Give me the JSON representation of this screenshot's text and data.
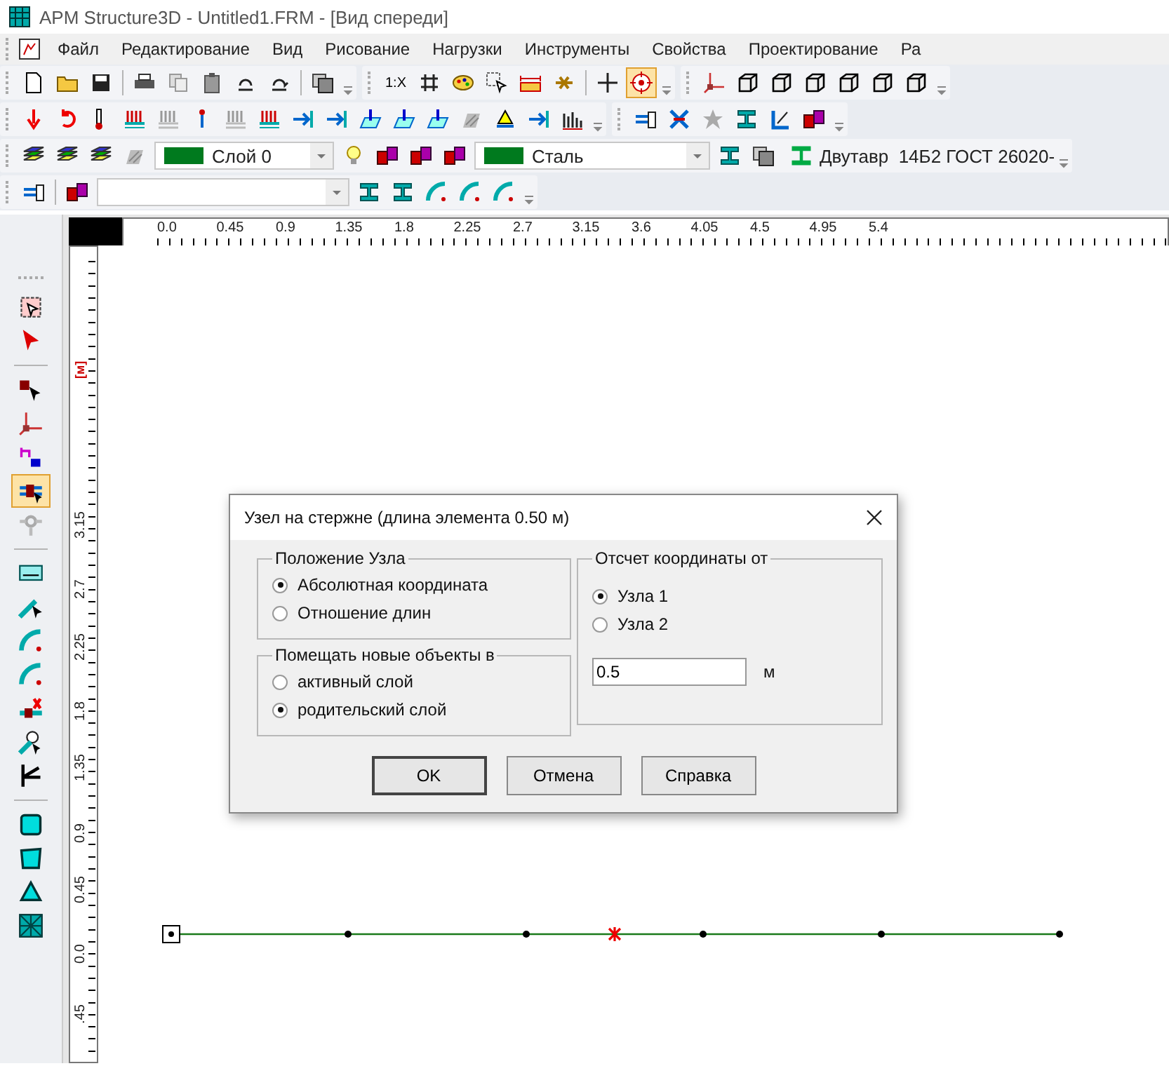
{
  "window": {
    "title": "APM Structure3D - Untitled1.FRM - [Вид спереди]"
  },
  "menu_bar": {
    "items": [
      "Файл",
      "Редактирование",
      "Вид",
      "Рисование",
      "Нагрузки",
      "Инструменты",
      "Свойства",
      "Проектирование",
      "Ра"
    ]
  },
  "toolbar_rows": [
    [
      {
        "items": [
          {
            "kind": "page",
            "selected": false
          },
          {
            "kind": "folder",
            "selected": false
          },
          {
            "kind": "disk",
            "selected": false
          },
          {
            "kind": "separator"
          },
          {
            "kind": "printer",
            "selected": false
          },
          {
            "kind": "copy",
            "selected": false
          },
          {
            "kind": "paste",
            "selected": false
          },
          {
            "kind": "undo",
            "selected": false
          },
          {
            "kind": "redo",
            "selected": false
          },
          {
            "kind": "separator"
          },
          {
            "kind": "stack",
            "selected": false
          }
        ]
      },
      {
        "items": [
          {
            "kind": "text",
            "text": "1:X",
            "selected": false
          },
          {
            "kind": "grid",
            "selected": false
          },
          {
            "kind": "palette",
            "selected": false
          },
          {
            "kind": "select",
            "selected": false
          },
          {
            "kind": "ruler",
            "selected": false
          },
          {
            "kind": "link",
            "selected": false
          },
          {
            "kind": "separator"
          },
          {
            "kind": "cross",
            "selected": false
          },
          {
            "kind": "target",
            "selected": true
          }
        ]
      },
      {
        "items": [
          {
            "kind": "axes",
            "selected": false
          },
          {
            "kind": "cube",
            "selected": false
          },
          {
            "kind": "cube",
            "selected": false
          },
          {
            "kind": "cube",
            "selected": false
          },
          {
            "kind": "cube",
            "selected": false
          },
          {
            "kind": "cube",
            "selected": false
          },
          {
            "kind": "cube",
            "selected": false
          }
        ]
      }
    ],
    [
      {
        "items": [
          {
            "kind": "down",
            "selected": false
          },
          {
            "kind": "curve",
            "selected": false
          },
          {
            "kind": "thermo",
            "selected": false
          },
          {
            "kind": "bars",
            "selected": false
          },
          {
            "kind": "greybars",
            "selected": false
          },
          {
            "kind": "figure",
            "selected": false
          },
          {
            "kind": "greybars",
            "selected": false
          },
          {
            "kind": "bars",
            "selected": false
          },
          {
            "kind": "bluearrow",
            "selected": false
          },
          {
            "kind": "bluearrow",
            "selected": false
          },
          {
            "kind": "plate",
            "selected": false
          },
          {
            "kind": "plate",
            "selected": false
          },
          {
            "kind": "plate",
            "selected": false
          },
          {
            "kind": "hatch",
            "selected": false
          },
          {
            "kind": "support",
            "selected": false
          },
          {
            "kind": "bluearrow",
            "selected": false
          },
          {
            "kind": "chart",
            "selected": false
          }
        ]
      },
      {
        "items": [
          {
            "kind": "beam",
            "selected": false
          },
          {
            "kind": "xcross",
            "selected": false
          },
          {
            "kind": "greystar",
            "selected": false
          },
          {
            "kind": "ibeam",
            "selected": false
          },
          {
            "kind": "angle",
            "selected": false
          },
          {
            "kind": "blocks",
            "selected": false
          }
        ]
      }
    ],
    [
      {
        "items": [
          {
            "kind": "layers",
            "selected": false
          },
          {
            "kind": "layers",
            "selected": false
          },
          {
            "kind": "layers",
            "selected": false
          },
          {
            "kind": "hatch",
            "selected": false
          },
          {
            "kind": "combo",
            "text": "Слой 0",
            "color": "#007a1e"
          },
          {
            "kind": "bulb",
            "selected": false
          },
          {
            "kind": "blocks",
            "selected": false
          },
          {
            "kind": "blocks",
            "selected": false
          },
          {
            "kind": "blocks",
            "selected": false
          },
          {
            "kind": "combo",
            "text": "Сталь",
            "color": "#007a1e"
          },
          {
            "kind": "ibeam",
            "selected": false
          },
          {
            "kind": "stack",
            "selected": false
          },
          {
            "kind": "section",
            "text": "Двутавр  14Б2 ГОСТ 26020-"
          }
        ]
      }
    ],
    [
      {
        "items": [
          {
            "kind": "beam",
            "selected": false
          },
          {
            "kind": "separator"
          },
          {
            "kind": "blocks",
            "selected": false
          },
          {
            "kind": "combo"
          },
          {
            "kind": "ibeam",
            "selected": false
          },
          {
            "kind": "ibeam",
            "selected": false
          },
          {
            "kind": "arc",
            "selected": false
          },
          {
            "kind": "arc",
            "selected": false
          },
          {
            "kind": "arc",
            "selected": false
          }
        ]
      }
    ]
  ],
  "left_toolbar": {
    "items": [
      {
        "kind": "hatchselect",
        "selected": false
      },
      {
        "kind": "pointer",
        "selected": false
      },
      {
        "kind": "separator"
      },
      {
        "kind": "nodeselect",
        "selected": false
      },
      {
        "kind": "axes",
        "selected": false
      },
      {
        "kind": "mass",
        "selected": false
      },
      {
        "kind": "beamselect",
        "selected": true
      },
      {
        "kind": "greynode",
        "selected": false
      },
      {
        "kind": "separator"
      },
      {
        "kind": "dimension",
        "selected": false
      },
      {
        "kind": "beamcursor",
        "selected": false
      },
      {
        "kind": "arc",
        "selected": false
      },
      {
        "kind": "arc",
        "selected": false
      },
      {
        "kind": "node",
        "selected": false
      },
      {
        "kind": "circlecursor",
        "selected": false
      },
      {
        "kind": "kshape",
        "selected": false
      },
      {
        "kind": "separator"
      },
      {
        "kind": "square",
        "selected": false
      },
      {
        "kind": "polygon",
        "selected": false
      },
      {
        "kind": "triangle",
        "selected": false
      },
      {
        "kind": "mesh",
        "selected": false
      }
    ]
  },
  "top_ruler": {
    "labels": [
      "0.0",
      "0.45",
      "0.9",
      "1.35",
      "1.8",
      "2.25",
      "2.7",
      "3.15",
      "3.6",
      "4.05",
      "4.5",
      "4.95",
      "5.4"
    ]
  },
  "left_ruler": {
    "unit": "[м]",
    "labels": [
      "3.15",
      "2.7",
      "2.25",
      "1.8",
      "1.35",
      "0.9",
      "0.45",
      "0.0",
      ".45"
    ]
  },
  "beam": {
    "nodes": [
      {
        "kind": "end"
      },
      {
        "kind": "node"
      },
      {
        "kind": "node"
      },
      {
        "kind": "new"
      },
      {
        "kind": "node"
      },
      {
        "kind": "node"
      },
      {
        "kind": "node"
      }
    ]
  },
  "dialog": {
    "title": "Узел на стержне (длина элемента 0.50 м)",
    "node_position": {
      "title": "Положение Узла",
      "options": [
        {
          "label": "Абсолютная координата",
          "selected": true
        },
        {
          "label": "Отношение длин",
          "selected": false
        }
      ]
    },
    "place_new_objects": {
      "title": "Помещать новые объекты в",
      "options": [
        {
          "label": "активный слой",
          "selected": false
        },
        {
          "label": "родительский слой",
          "selected": true
        }
      ]
    },
    "origin": {
      "title": "Отсчет координаты от",
      "options": [
        {
          "label": "Узла 1",
          "selected": true
        },
        {
          "label": "Узла 2",
          "selected": false
        }
      ],
      "value": "0.5",
      "unit": "м"
    },
    "buttons": [
      "OK",
      "Отмена",
      "Справка"
    ]
  }
}
